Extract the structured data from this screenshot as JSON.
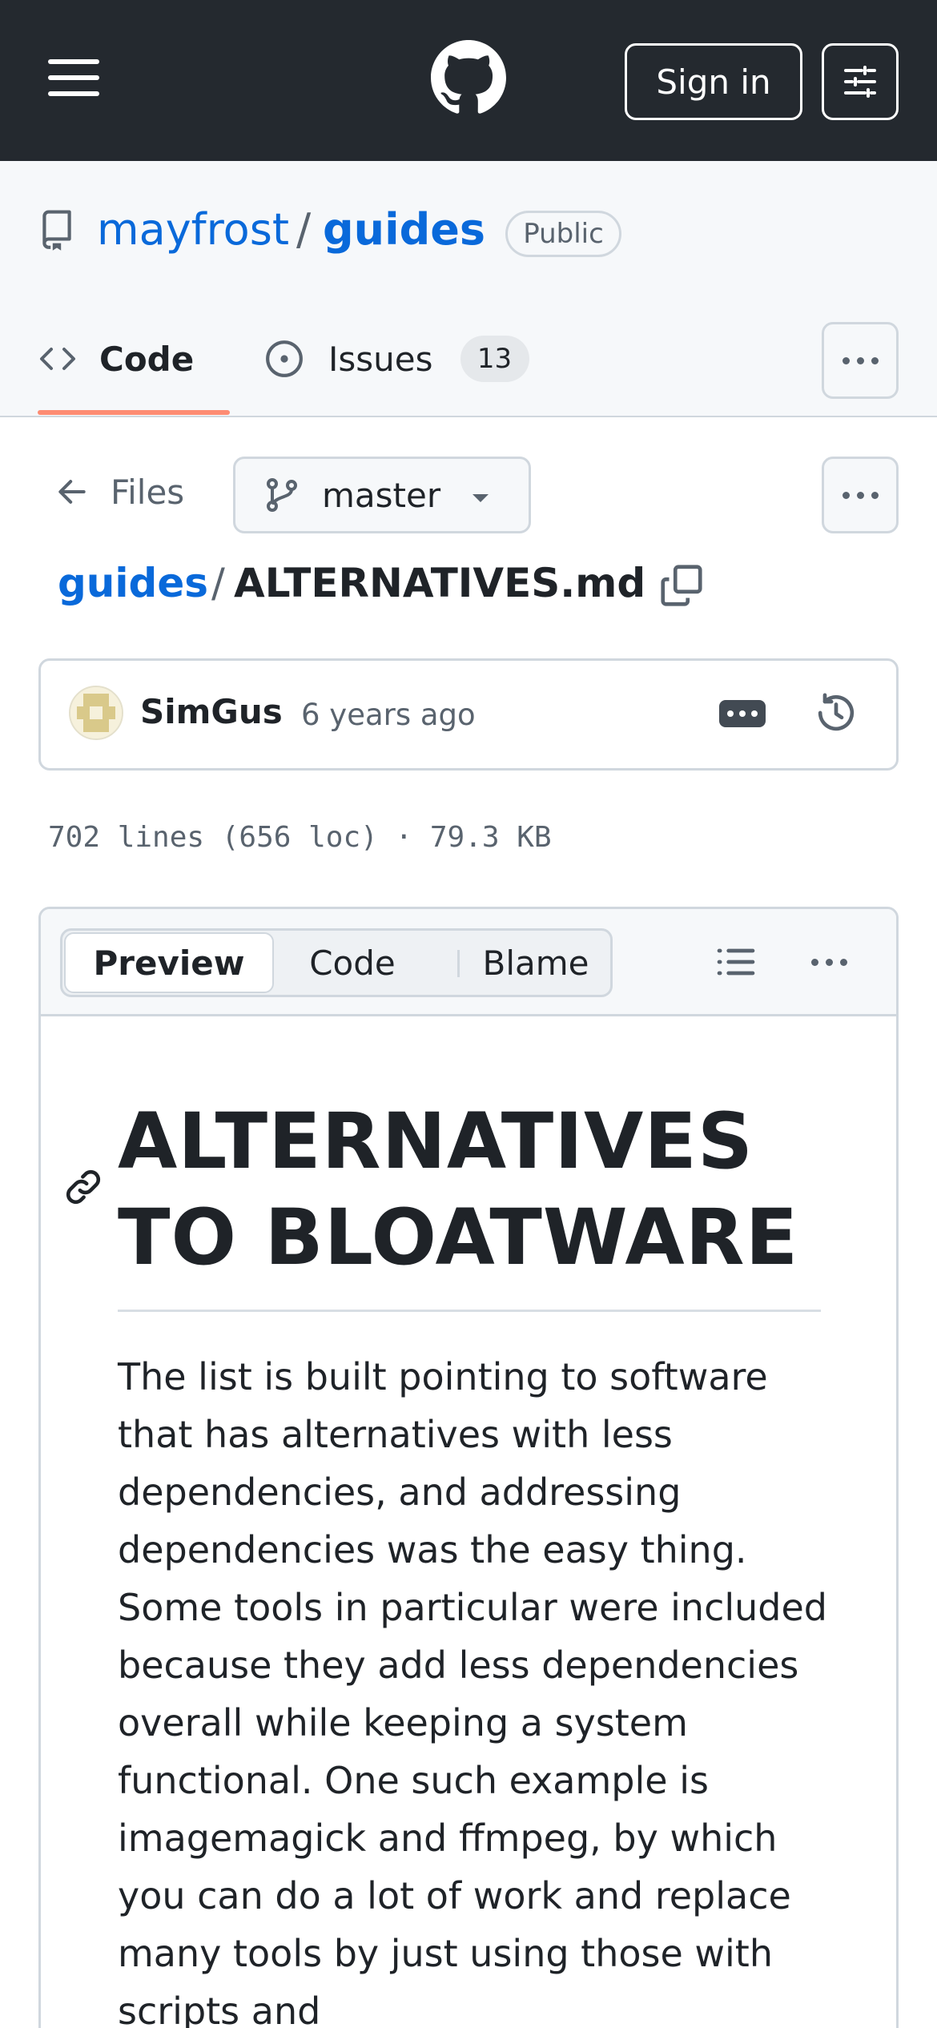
{
  "header": {
    "menu_icon": "hamburger-icon",
    "logo_icon": "github-logo-icon",
    "sign_in_label": "Sign in",
    "settings_icon": "sliders-icon"
  },
  "repo": {
    "owner": "mayfrost",
    "separator": "/",
    "name": "guides",
    "visibility": "Public"
  },
  "tabs": [
    {
      "label": "Code",
      "icon": "code-icon",
      "selected": true
    },
    {
      "label": "Issues",
      "icon": "issue-opened-icon",
      "count": "13"
    }
  ],
  "file_nav": {
    "back_label": "Files",
    "branch": "master"
  },
  "breadcrumb": {
    "repo": "guides",
    "separator": "/",
    "file": "ALTERNATIVES.md"
  },
  "commit": {
    "author": "SimGus",
    "time": "6 years ago"
  },
  "file_stats": "702 lines (656 loc) · 79.3 KB",
  "view_modes": [
    "Preview",
    "Code",
    "Blame"
  ],
  "markdown": {
    "title": "ALTERNATIVES TO BLOATWARE",
    "paragraph": "The list is built pointing to software that has alternatives with less dependencies, and addressing dependencies was the easy thing. Some tools in particular were included because they add less dependencies overall while keeping a system functional. One such example is imagemagick and ffmpeg, by which you can do a lot of work and replace many tools by just using those with scripts and"
  },
  "colors": {
    "header_bg": "#24292f",
    "link": "#0969da",
    "tab_underline": "#fd8c73",
    "muted": "#59636e"
  }
}
